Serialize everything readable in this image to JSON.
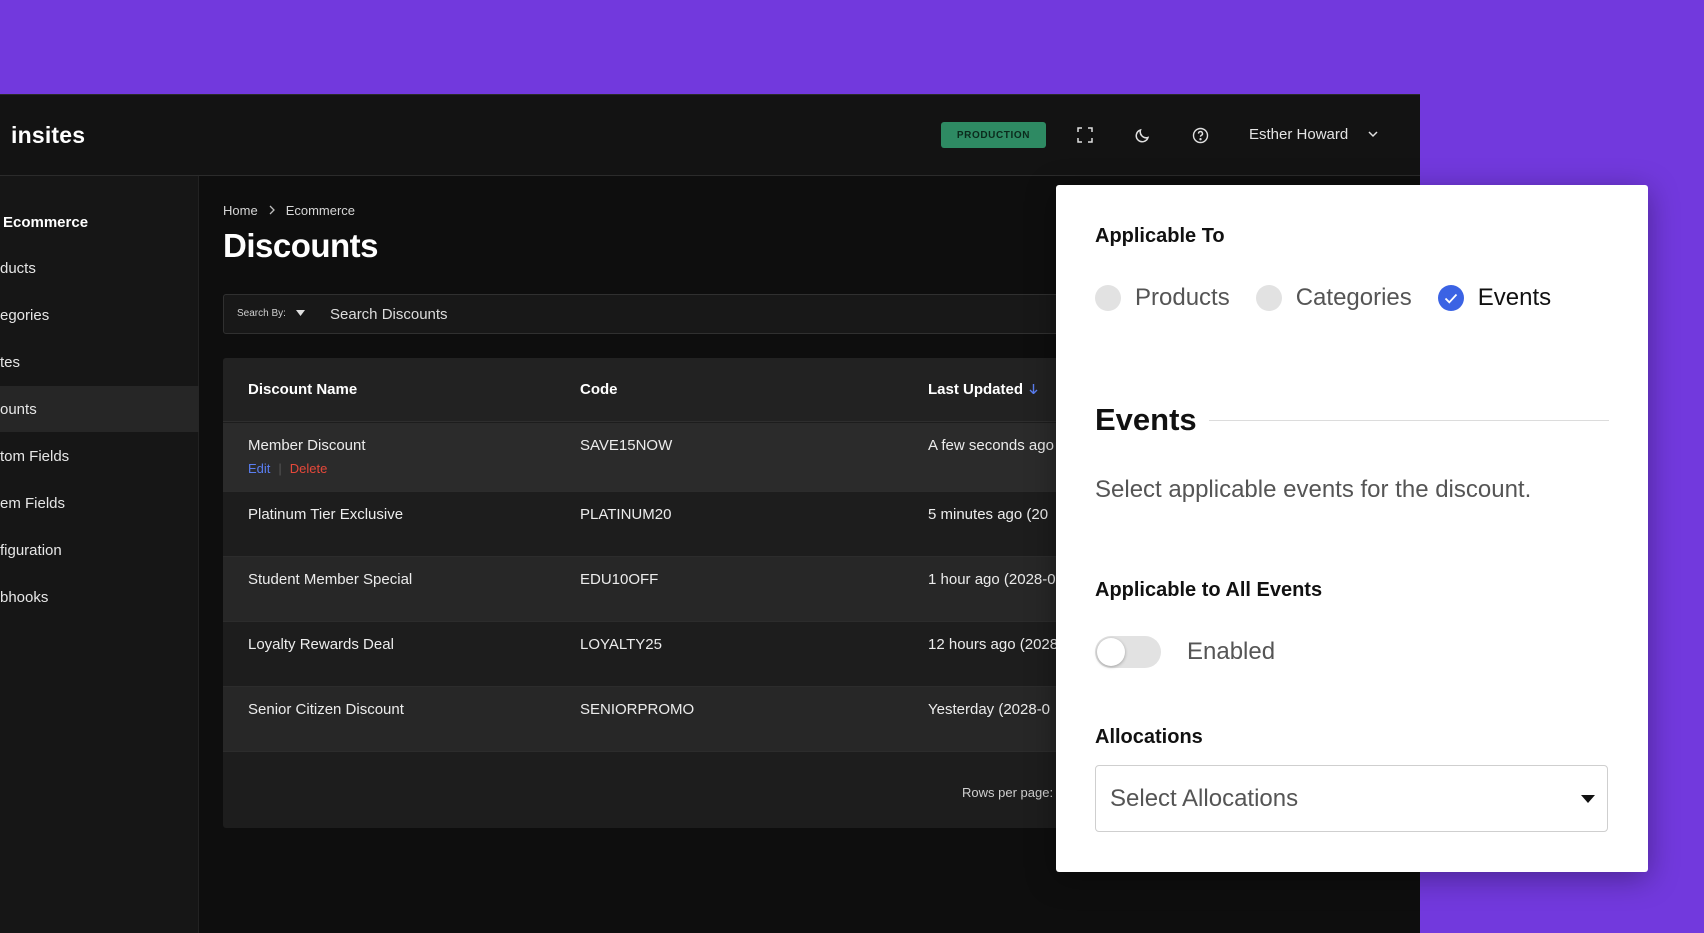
{
  "topbar": {
    "logo": "insites",
    "env_badge": "PRODUCTION",
    "icons": [
      "fullscreen-icon",
      "moon-icon",
      "help-icon"
    ],
    "user_name": "Esther Howard"
  },
  "sidebar": {
    "items": [
      {
        "label": "Ecommerce",
        "type": "header"
      },
      {
        "label": "ducts"
      },
      {
        "label": "egories"
      },
      {
        "label": "tes"
      },
      {
        "label": "ounts",
        "active": true
      },
      {
        "label": "tom Fields"
      },
      {
        "label": "em Fields"
      },
      {
        "label": "figuration"
      },
      {
        "label": "bhooks"
      }
    ]
  },
  "breadcrumb": {
    "home": "Home",
    "current": "Ecommerce"
  },
  "page": {
    "title": "Discounts"
  },
  "search": {
    "by_label": "Search By:",
    "placeholder": "Search Discounts"
  },
  "table": {
    "headers": {
      "name": "Discount Name",
      "code": "Code",
      "updated": "Last Updated"
    },
    "row_actions": {
      "edit": "Edit",
      "delete": "Delete"
    },
    "rows": [
      {
        "name": "Member Discount",
        "code": "SAVE15NOW",
        "updated": "A few seconds ago"
      },
      {
        "name": "Platinum Tier Exclusive",
        "code": "PLATINUM20",
        "updated": "5 minutes ago (20"
      },
      {
        "name": "Student Member Special",
        "code": "EDU10OFF",
        "updated": "1 hour ago (2028-0"
      },
      {
        "name": "Loyalty Rewards Deal",
        "code": "LOYALTY25",
        "updated": "12 hours ago (2028"
      },
      {
        "name": "Senior Citizen Discount",
        "code": "SENIORPROMO",
        "updated": "Yesterday (2028-0"
      }
    ],
    "rows_per_page_label": "Rows per page:"
  },
  "panel": {
    "applicable_to_title": "Applicable To",
    "options": [
      {
        "label": "Products",
        "checked": false
      },
      {
        "label": "Categories",
        "checked": false
      },
      {
        "label": "Events",
        "checked": true
      }
    ],
    "events_heading": "Events",
    "events_description": "Select applicable events for the discount.",
    "all_events_title": "Applicable to All Events",
    "toggle_label": "Enabled",
    "toggle_on": false,
    "allocations_title": "Allocations",
    "allocations_placeholder": "Select Allocations"
  },
  "colors": {
    "background": "#7239dd",
    "app_bg": "#0e0e0e",
    "badge": "#2e8a63",
    "accent": "#3b63e4",
    "delete": "#e5483a"
  }
}
